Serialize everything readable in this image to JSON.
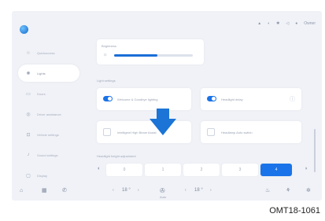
{
  "status_icons": [
    "signal-icon",
    "wifi-icon",
    "bluetooth-icon",
    "volume-icon",
    "profile-icon"
  ],
  "status_text": "Owner",
  "sidebar": {
    "items": [
      {
        "label": "Quickaccess",
        "icon": "star-icon"
      },
      {
        "label": "Lights",
        "icon": "light-icon"
      },
      {
        "label": "Doors",
        "icon": "door-icon"
      },
      {
        "label": "Driver assistance",
        "icon": "steering-icon"
      },
      {
        "label": "Vehicle settings",
        "icon": "car-icon"
      },
      {
        "label": "Sound settings",
        "icon": "sound-icon"
      },
      {
        "label": "Display",
        "icon": "display-icon"
      }
    ],
    "active_index": 1
  },
  "main": {
    "brightness_label": "Brightness",
    "brightness_level_percent": 55,
    "exterior_label": "Light settings",
    "toggle_cards": [
      {
        "label": "Welcome & Goodbye lighting",
        "on": true
      },
      {
        "label": "Headlight delay",
        "on": true
      }
    ],
    "plain_cards": [
      {
        "label": "Intelligent High Beam Assist"
      },
      {
        "label": "Headlamp Auto switch"
      }
    ],
    "height_label": "Headlight height adjustment",
    "height_options": [
      "0",
      "1",
      "2",
      "3",
      "4"
    ],
    "height_selected": 4
  },
  "bottom": {
    "temp_left": "18 °",
    "temp_right": "18 °",
    "auto_label": "Auto"
  },
  "caption": "OMT18-1061"
}
